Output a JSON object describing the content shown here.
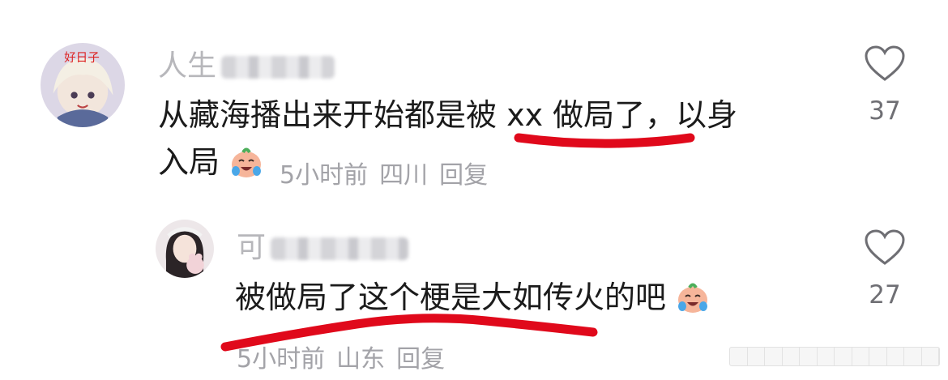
{
  "comments": [
    {
      "username": "人生",
      "text": "从藏海播出来开始都是被 xx 做局了，以身入局",
      "text_line1": "从藏海播出来开始都是被 xx 做局了，以身",
      "text_line2": "入局",
      "time": "5小时前",
      "location": "四川",
      "reply_label": "回复",
      "like_count": "37"
    },
    {
      "username": "可",
      "text": "被做局了这个梗是大如传火的吧",
      "time": "5小时前",
      "location": "山东",
      "reply_label": "回复",
      "like_count": "27"
    }
  ],
  "colors": {
    "highlight_underline": "#e0091b",
    "username": "#b7b7bb",
    "meta": "#a3a3a8",
    "body": "#1b1b1b"
  },
  "icons": {
    "like": "heart-outline-icon",
    "emoji": "crying-laughing-emoji-icon"
  }
}
